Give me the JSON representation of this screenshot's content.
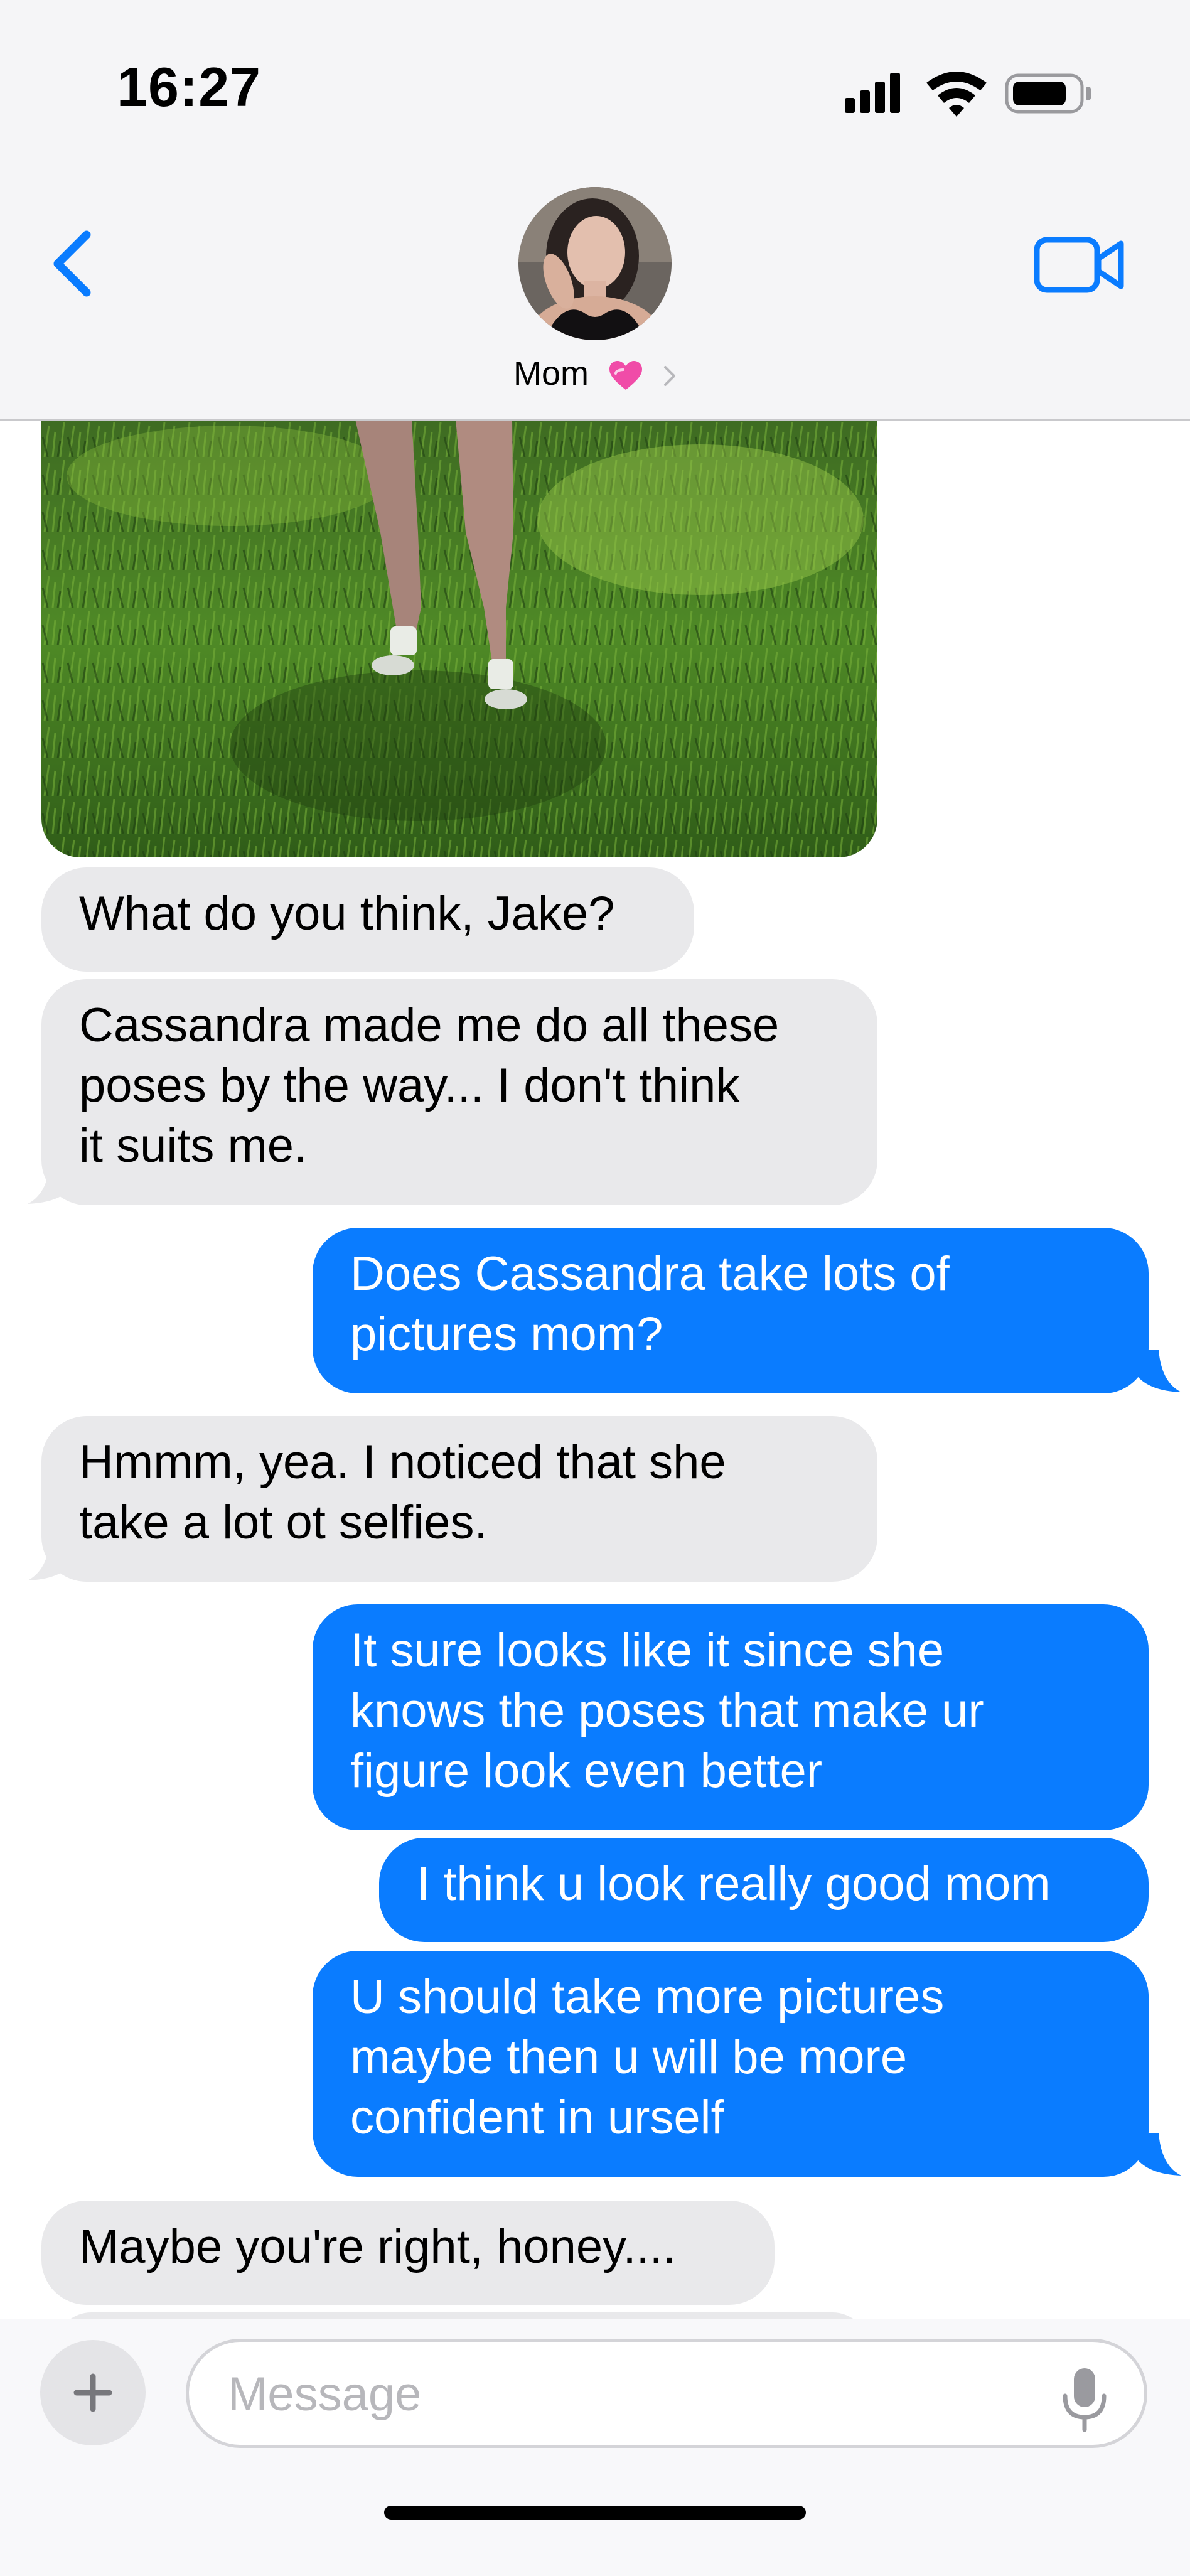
{
  "status_bar": {
    "time": "16:27",
    "icons": [
      "signal-icon",
      "wifi-icon",
      "battery-icon"
    ]
  },
  "header": {
    "contact_name": "Mom",
    "contact_emoji": "heart-icon",
    "accent_color": "#0a7cff"
  },
  "messages": [
    {
      "direction": "in",
      "text": "What do you think, Jake?"
    },
    {
      "direction": "in",
      "text": "Cassandra made me do all these\nposes by the way... I don't think\nit suits me."
    },
    {
      "direction": "out",
      "text": "Does Cassandra take lots of\npictures mom?"
    },
    {
      "direction": "in",
      "text": "Hmmm, yea. I noticed that she\ntake a lot ot selfies."
    },
    {
      "direction": "out",
      "text": "It sure looks like it since she\nknows the poses that make ur\nfigure look even better"
    },
    {
      "direction": "out",
      "text": "I think u look really good mom"
    },
    {
      "direction": "out",
      "text": "U should take more pictures\nmaybe then u will be more\nconfident in urself"
    },
    {
      "direction": "in",
      "text": "Maybe you're right, honey...."
    }
  ],
  "composer": {
    "placeholder": "Message"
  },
  "colors": {
    "incoming_bubble": "#e9e9eb",
    "outgoing_bubble": "#0a7cff",
    "header_bg": "#f5f5f7"
  }
}
